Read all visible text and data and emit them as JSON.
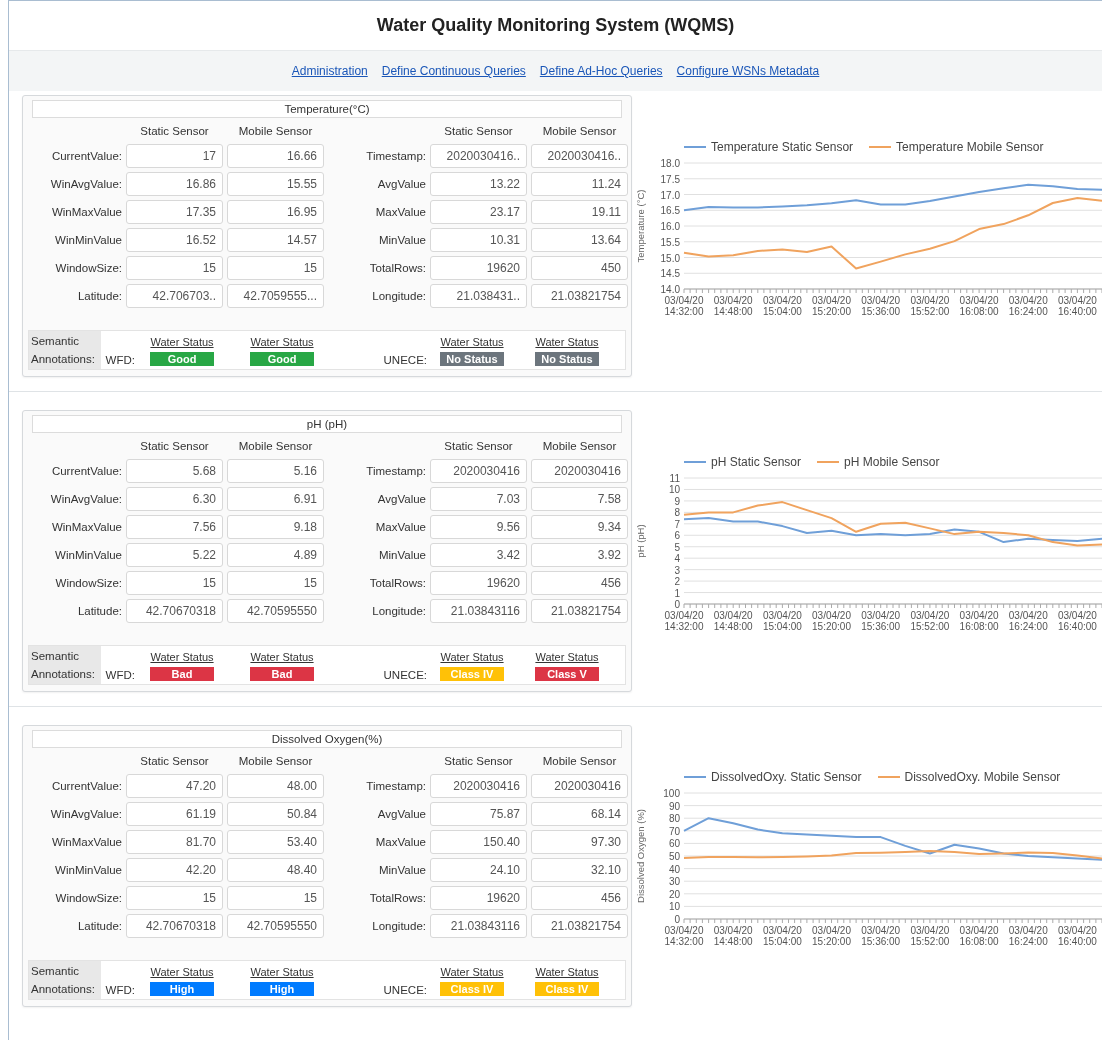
{
  "title": "Water Quality Monitoring System (WQMS)",
  "nav": [
    "Administration",
    "Define Continuous Queries",
    "Define Ad-Hoc Queries",
    "Configure WSNs Metadata"
  ],
  "sections": [
    {
      "title": "Temperature(°C)",
      "headers": [
        "Static Sensor",
        "Mobile Sensor",
        "Static Sensor",
        "Mobile Sensor"
      ],
      "rows": [
        [
          "CurrentValue:",
          "17",
          "16.66",
          "Timestamp:",
          "2020030416..",
          "2020030416.."
        ],
        [
          "WinAvgValue:",
          "16.86",
          "15.55",
          "AvgValue",
          "13.22",
          "11.24"
        ],
        [
          "WinMaxValue",
          "17.35",
          "16.95",
          "MaxValue",
          "23.17",
          "19.11"
        ],
        [
          "WinMinValue",
          "16.52",
          "14.57",
          "MinValue",
          "10.31",
          "13.64"
        ],
        [
          "WindowSize:",
          "15",
          "15",
          "TotalRows:",
          "19620",
          "450"
        ],
        [
          "Latitude:",
          "42.706703..",
          "42.7059555...",
          "Longitude:",
          "21.038431..",
          "21.03821754"
        ]
      ],
      "annotations": {
        "label": "Semantic Annotations:",
        "wfd_label": "WFD:",
        "unece_label": "UNECE:",
        "wfd": [
          {
            "link": "Water Status",
            "label": "Good",
            "color": "#28a745"
          },
          {
            "link": "Water Status",
            "label": "Good",
            "color": "#28a745"
          }
        ],
        "unece": [
          {
            "link": "Water Status",
            "label": "No Status",
            "color": "#6c757d"
          },
          {
            "link": "Water Status",
            "label": "No Status",
            "color": "#6c757d"
          }
        ]
      },
      "chart_data": {
        "type": "line",
        "grid": true,
        "legend": "top",
        "ylabel": "Temperature (°C)",
        "categories": [
          "03/04/20 14:32:00",
          null,
          "03/04/20 14:48:00",
          null,
          "03/04/20 15:04:00",
          null,
          "03/04/20 15:20:00",
          null,
          "03/04/20 15:36:00",
          null,
          "03/04/20 15:52:00",
          null,
          "03/04/20 16:08:00",
          null,
          "03/04/20 16:24:00",
          null,
          "03/04/20 16:40:00",
          null
        ],
        "ylim": [
          14,
          18
        ],
        "yticks": [
          {
            "value": 14,
            "label": "14.0"
          },
          {
            "value": 14.5,
            "label": "14.5"
          },
          {
            "value": 15,
            "label": "15.0"
          },
          {
            "value": 15.5,
            "label": "15.5"
          },
          {
            "value": 16,
            "label": "16.0"
          },
          {
            "value": 16.5,
            "label": "16.5"
          },
          {
            "value": 17,
            "label": "17.0"
          },
          {
            "value": 17.5,
            "label": "17.5"
          },
          {
            "value": 18,
            "label": "18.0"
          }
        ],
        "series": [
          {
            "name": "Temperature Static Sensor",
            "color": "#6f9fd8",
            "values": [
              16.5,
              16.6,
              16.59,
              16.59,
              16.62,
              16.66,
              16.72,
              16.82,
              16.68,
              16.68,
              16.79,
              16.94,
              17.08,
              17.2,
              17.31,
              17.26,
              17.17,
              17.15
            ]
          },
          {
            "name": "Temperature Mobile Sensor",
            "color": "#f0a35e",
            "values": [
              15.15,
              15.03,
              15.07,
              15.21,
              15.25,
              15.17,
              15.35,
              14.65,
              14.87,
              15.1,
              15.28,
              15.52,
              15.9,
              16.06,
              16.34,
              16.73,
              16.89,
              16.8
            ]
          }
        ]
      }
    },
    {
      "title": "pH (pH)",
      "headers": [
        "Static Sensor",
        "Mobile Sensor",
        "Static Sensor",
        "Mobile Sensor"
      ],
      "rows": [
        [
          "CurrentValue:",
          "5.68",
          "5.16",
          "Timestamp:",
          "2020030416",
          "2020030416"
        ],
        [
          "WinAvgValue:",
          "6.30",
          "6.91",
          "AvgValue",
          "7.03",
          "7.58"
        ],
        [
          "WinMaxValue",
          "7.56",
          "9.18",
          "MaxValue",
          "9.56",
          "9.34"
        ],
        [
          "WinMinValue",
          "5.22",
          "4.89",
          "MinValue",
          "3.42",
          "3.92"
        ],
        [
          "WindowSize:",
          "15",
          "15",
          "TotalRows:",
          "19620",
          "456"
        ],
        [
          "Latitude:",
          "42.70670318",
          "42.70595550",
          "Longitude:",
          "21.03843116",
          "21.03821754"
        ]
      ],
      "annotations": {
        "label": "Semantic Annotations:",
        "wfd_label": "WFD:",
        "unece_label": "UNECE:",
        "wfd": [
          {
            "link": "Water Status",
            "label": "Bad",
            "color": "#dc3545"
          },
          {
            "link": "Water Status",
            "label": "Bad",
            "color": "#dc3545"
          }
        ],
        "unece": [
          {
            "link": "Water Status",
            "label": "Class IV",
            "color": "#ffc107"
          },
          {
            "link": "Water Status",
            "label": "Class V",
            "color": "#dc3545"
          }
        ]
      },
      "chart_data": {
        "type": "line",
        "grid": true,
        "legend": "top",
        "ylabel": "pH (pH)",
        "categories": [
          "03/04/20 14:32:00",
          null,
          "03/04/20 14:48:00",
          null,
          "03/04/20 15:04:00",
          null,
          "03/04/20 15:20:00",
          null,
          "03/04/20 15:36:00",
          null,
          "03/04/20 15:52:00",
          null,
          "03/04/20 16:08:00",
          null,
          "03/04/20 16:24:00",
          null,
          "03/04/20 16:40:00",
          null
        ],
        "ylim": [
          0,
          11
        ],
        "yticks": [
          0,
          1,
          2,
          3,
          4,
          5,
          6,
          7,
          8,
          9,
          10,
          11
        ],
        "series": [
          {
            "name": "pH Static Sensor",
            "color": "#6f9fd8",
            "values": [
              7.4,
              7.5,
              7.2,
              7.2,
              6.8,
              6.2,
              6.4,
              6.0,
              6.1,
              6.0,
              6.1,
              6.5,
              6.3,
              5.4,
              5.7,
              5.6,
              5.5,
              5.7
            ]
          },
          {
            "name": "pH Mobile Sensor",
            "color": "#f0a35e",
            "values": [
              7.8,
              8.0,
              8.0,
              8.6,
              8.9,
              8.2,
              7.5,
              6.3,
              7.0,
              7.1,
              6.6,
              6.1,
              6.3,
              6.2,
              6.0,
              5.4,
              5.1,
              5.2
            ]
          }
        ]
      }
    },
    {
      "title": "Dissolved Oxygen(%)",
      "headers": [
        "Static Sensor",
        "Mobile Sensor",
        "Static Sensor",
        "Mobile Sensor"
      ],
      "rows": [
        [
          "CurrentValue:",
          "47.20",
          "48.00",
          "Timestamp:",
          "2020030416",
          "2020030416"
        ],
        [
          "WinAvgValue:",
          "61.19",
          "50.84",
          "AvgValue",
          "75.87",
          "68.14"
        ],
        [
          "WinMaxValue",
          "81.70",
          "53.40",
          "MaxValue",
          "150.40",
          "97.30"
        ],
        [
          "WinMinValue",
          "42.20",
          "48.40",
          "MinValue",
          "24.10",
          "32.10"
        ],
        [
          "WindowSize:",
          "15",
          "15",
          "TotalRows:",
          "19620",
          "456"
        ],
        [
          "Latitude:",
          "42.70670318",
          "42.70595550",
          "Longitude:",
          "21.03843116",
          "21.03821754"
        ]
      ],
      "annotations": {
        "label": "Semantic Annotations:",
        "wfd_label": "WFD:",
        "unece_label": "UNECE:",
        "wfd": [
          {
            "link": "Water Status",
            "label": "High",
            "color": "#007bff"
          },
          {
            "link": "Water Status",
            "label": "High",
            "color": "#007bff"
          }
        ],
        "unece": [
          {
            "link": "Water Status",
            "label": "Class IV",
            "color": "#ffc107"
          },
          {
            "link": "Water Status",
            "label": "Class IV",
            "color": "#ffc107"
          }
        ]
      },
      "chart_data": {
        "type": "line",
        "grid": true,
        "legend": "top",
        "ylabel": "Dissolved Oxygen (%)",
        "categories": [
          "03/04/20 14:32:00",
          null,
          "03/04/20 14:48:00",
          null,
          "03/04/20 15:04:00",
          null,
          "03/04/20 15:20:00",
          null,
          "03/04/20 15:36:00",
          null,
          "03/04/20 15:52:00",
          null,
          "03/04/20 16:08:00",
          null,
          "03/04/20 16:24:00",
          null,
          "03/04/20 16:40:00",
          null
        ],
        "ylim": [
          0,
          100
        ],
        "yticks": [
          0,
          10,
          20,
          30,
          40,
          50,
          60,
          70,
          80,
          90,
          100
        ],
        "series": [
          {
            "name": "DissolvedOxy. Static Sensor",
            "color": "#6f9fd8",
            "values": [
              70,
              80,
              76,
              71,
              68,
              67,
              66,
              65,
              65,
              58,
              52,
              59,
              56,
              52,
              50,
              49,
              48,
              47
            ]
          },
          {
            "name": "DissolvedOxy. Mobile Sensor",
            "color": "#f0a35e",
            "values": [
              48.5,
              49.3,
              49.2,
              49,
              49.1,
              49.6,
              50.5,
              52.3,
              52.5,
              53.2,
              53.9,
              53.2,
              51.5,
              51.9,
              52.7,
              52.4,
              50.5,
              48
            ]
          }
        ]
      }
    }
  ]
}
